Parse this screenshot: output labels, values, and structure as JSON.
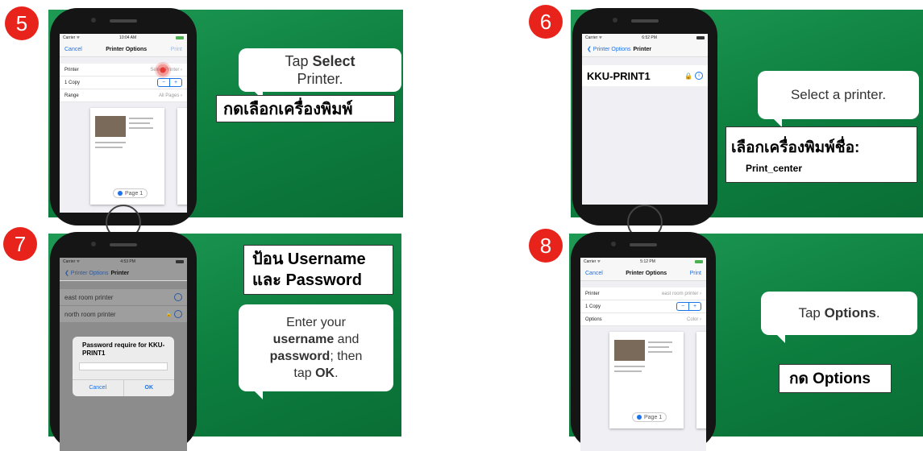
{
  "steps": {
    "s5": {
      "number": "5",
      "status_carrier": "Carrier ᯤ",
      "status_time": "10:04 AM",
      "nav_left": "Cancel",
      "nav_title": "Printer Options",
      "nav_right": "Print",
      "row_printer_label": "Printer",
      "row_printer_value": "Select Printer",
      "row_copy_label": "1 Copy",
      "row_range_label": "Range",
      "row_range_value": "All Pages",
      "stepper_minus": "−",
      "stepper_plus": "+",
      "page_label": "Page 1",
      "bubble_pre": "Tap ",
      "bubble_bold": "Select",
      "bubble_post": "Printer.",
      "thai_label": "กดเลือกเครื่องพิมพ์"
    },
    "s6": {
      "number": "6",
      "status_carrier": "Carrier ᯤ",
      "status_time": "6:52 PM",
      "nav_back": "❮ Printer Options",
      "nav_title": "Printer",
      "printer_name": "KKU-PRINT1",
      "bubble_text": "Select a printer.",
      "thai_label": "เลือกเครื่องพิมพ์ชื่อ:",
      "thai_sub": "Print_center"
    },
    "s7": {
      "number": "7",
      "status_carrier": "Carrier ᯤ",
      "status_time": "4:53 PM",
      "nav_back": "❮ Printer Options",
      "nav_title": "Printer",
      "printer_1": "east room printer",
      "printer_2": "north room printer",
      "dialog_title": "Password require for KKU-PRINT1",
      "dialog_cancel": "Cancel",
      "dialog_ok": "OK",
      "thai_label_1": "ป้อน Username",
      "thai_label_2": "และ Password",
      "bubble_l1": "Enter your",
      "bubble_l2_bold": "username",
      "bubble_l2_post": " and",
      "bubble_l3_bold": "password",
      "bubble_l3_post": "; then",
      "bubble_l4_pre": "tap ",
      "bubble_l4_bold": "OK",
      "bubble_l4_post": "."
    },
    "s8": {
      "number": "8",
      "status_carrier": "Carrier ᯤ",
      "status_time": "5:12 PM",
      "nav_left": "Cancel",
      "nav_title": "Printer Options",
      "nav_right": "Print",
      "row_printer_label": "Printer",
      "row_printer_value": "east room printer",
      "row_copy_label": "1 Copy",
      "row_options_label": "Options",
      "row_options_value": "Color",
      "stepper_minus": "−",
      "stepper_plus": "+",
      "page_label": "Page 1",
      "bubble_pre": "Tap ",
      "bubble_bold": "Options",
      "bubble_post": ".",
      "thai_label": "กด Options"
    }
  },
  "colors": {
    "panel_green": "#0d7f3f",
    "badge_red": "#e8231b",
    "ios_blue": "#1a73e8"
  }
}
